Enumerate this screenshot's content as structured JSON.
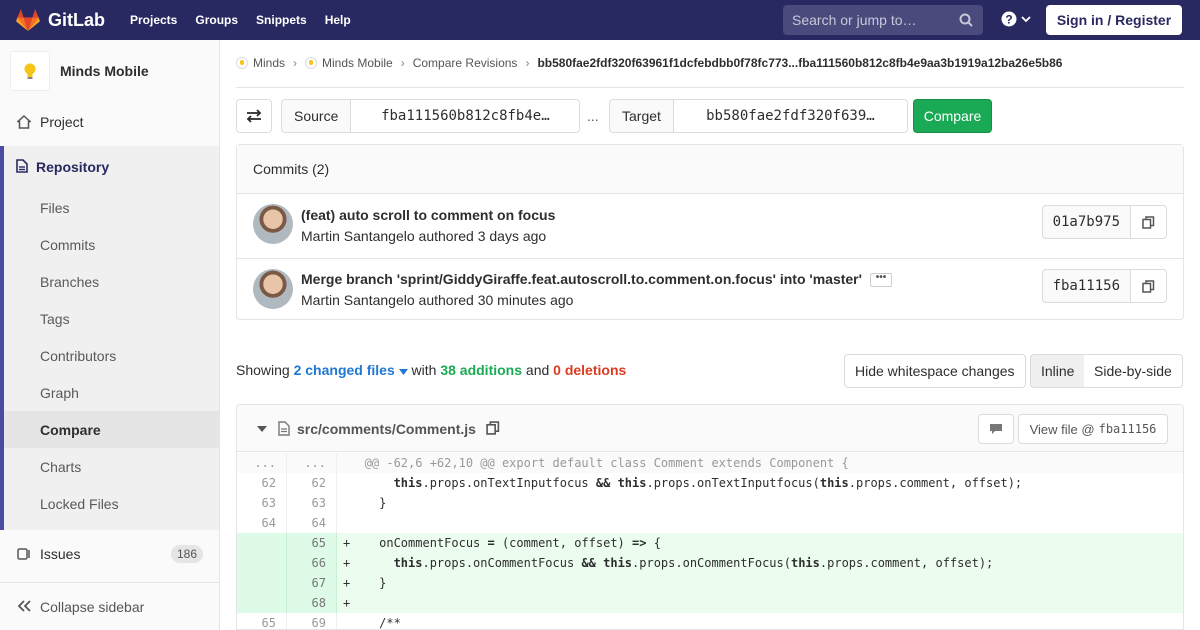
{
  "navbar": {
    "brand": "GitLab",
    "links": [
      "Projects",
      "Groups",
      "Snippets",
      "Help"
    ],
    "search_placeholder": "Search or jump to…",
    "signin": "Sign in / Register"
  },
  "sidebar": {
    "project_name": "Minds Mobile",
    "project_label": "Project",
    "repository_label": "Repository",
    "repo_items": [
      "Files",
      "Commits",
      "Branches",
      "Tags",
      "Contributors",
      "Graph",
      "Compare",
      "Charts",
      "Locked Files"
    ],
    "active_item": "Compare",
    "issues_label": "Issues",
    "issues_count": "186",
    "collapse_label": "Collapse sidebar"
  },
  "breadcrumb": {
    "items": [
      "Minds",
      "Minds Mobile",
      "Compare Revisions"
    ],
    "current": "bb580fae2fdf320f63961f1dcfebdbb0f78fc773...fba111560b812c8fb4e9aa3b1919a12ba26e5b86"
  },
  "compare": {
    "source_label": "Source",
    "source_value": "fba111560b812c8fb4e…",
    "separator": "...",
    "target_label": "Target",
    "target_value": "bb580fae2fdf320f639…",
    "compare_button": "Compare"
  },
  "commits": {
    "header": "Commits (2)",
    "items": [
      {
        "title": "(feat) auto scroll to comment on focus",
        "author": "Martin Santangelo",
        "action": "authored",
        "time": "3 days ago",
        "sha": "01a7b975"
      },
      {
        "title": "Merge branch 'sprint/GiddyGiraffe.feat.autoscroll.to.comment.on.focus' into 'master'",
        "author": "Martin Santangelo",
        "action": "authored",
        "time": "30 minutes ago",
        "sha": "fba11156"
      }
    ]
  },
  "summary": {
    "showing": "Showing",
    "files": "2 changed files",
    "with": "with",
    "additions": "38 additions",
    "and": "and",
    "deletions": "0 deletions",
    "hide_whitespace": "Hide whitespace changes",
    "inline": "Inline",
    "side_by_side": "Side-by-side"
  },
  "file": {
    "path": "src/comments/Comment.js",
    "view_file_label": "View file @",
    "view_file_sha": "fba11156"
  },
  "diff": [
    {
      "type": "match",
      "old": "...",
      "new": "...",
      "prefix": " ",
      "code": "@@ -62,6 +62,10 @@ export default class Comment extends Component {"
    },
    {
      "type": "ctx",
      "old": "62",
      "new": "62",
      "prefix": " ",
      "code": "    this.props.onTextInputfocus && this.props.onTextInputfocus(this.props.comment, offset);"
    },
    {
      "type": "ctx",
      "old": "63",
      "new": "63",
      "prefix": " ",
      "code": "  }"
    },
    {
      "type": "ctx",
      "old": "64",
      "new": "64",
      "prefix": " ",
      "code": ""
    },
    {
      "type": "add",
      "old": "",
      "new": "65",
      "prefix": "+",
      "code": "  onCommentFocus = (comment, offset) => {"
    },
    {
      "type": "add",
      "old": "",
      "new": "66",
      "prefix": "+",
      "code": "    this.props.onCommentFocus && this.props.onCommentFocus(this.props.comment, offset);"
    },
    {
      "type": "add",
      "old": "",
      "new": "67",
      "prefix": "+",
      "code": "  }"
    },
    {
      "type": "add",
      "old": "",
      "new": "68",
      "prefix": "+",
      "code": ""
    },
    {
      "type": "ctx",
      "old": "65",
      "new": "69",
      "prefix": " ",
      "code": "  /**"
    }
  ]
}
